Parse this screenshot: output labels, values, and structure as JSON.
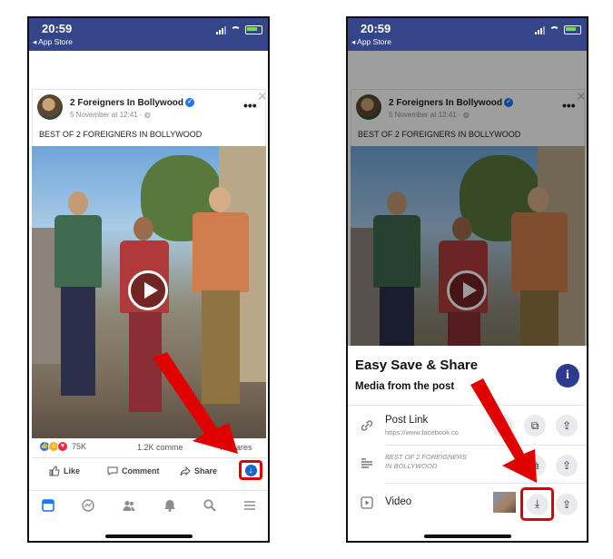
{
  "status": {
    "time": "20:59",
    "back_label": "◂ App Store"
  },
  "post": {
    "author": "2 Foreigners In Bollywood",
    "date": "5 November at 12:41 · ",
    "caption": "BEST OF 2 FOREIGNERS IN BOLLYWOOD",
    "reaction_count": "75K",
    "comments": "1.2K comme",
    "shares": "K shares",
    "actions": {
      "like": "Like",
      "comment": "Comment",
      "share": "Share"
    }
  },
  "sheet": {
    "title": "Easy Save & Share",
    "subtitle": "Media from the post",
    "rows": [
      {
        "label": "Post Link",
        "sub": "https://www.facebook.co"
      },
      {
        "label": "BEST OF 2 FOREIGNERS IN BOLLYWOOD"
      },
      {
        "label": "Video"
      }
    ]
  },
  "icons": {
    "more": "more-icon",
    "close": "close-icon",
    "verified": "verified-icon",
    "play": "play-icon",
    "download": "download-icon",
    "info": "info-icon",
    "link": "link-icon",
    "text": "text-icon",
    "video": "video-icon",
    "copy": "copy-icon",
    "share": "share-icon"
  },
  "colors": {
    "header": "#34458a",
    "highlight": "#e00000",
    "fb_blue": "#1877f2",
    "info_button": "#2c3b8f"
  }
}
